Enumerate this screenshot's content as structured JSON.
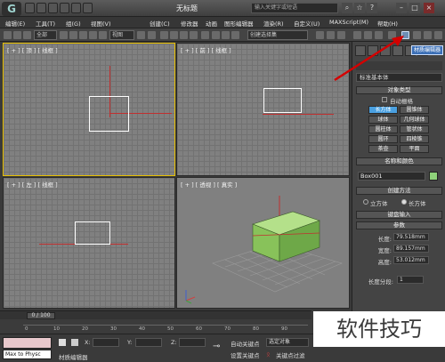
{
  "app": {
    "logo": "G",
    "title": "无标题",
    "search_placeholder": "输入关键字或短语"
  },
  "menu": [
    "编辑(E)",
    "工具(T)",
    "组(G)",
    "视图(V)",
    "创建(C)",
    "修改器",
    "动画",
    "图形编辑器",
    "渲染(R)",
    "自定义(U)",
    "MAXScript(M)",
    "帮助(H)"
  ],
  "toolbar": {
    "filter_select": "全部",
    "view_select": "视图",
    "selection_set": "创建选择集"
  },
  "viewports": [
    {
      "label": "[ + ] [ 顶 ] [ 线框 ]"
    },
    {
      "label": "[ + ] [ 前 ] [ 线框 ]"
    },
    {
      "label": "[ + ] [ 左 ] [ 线框 ]"
    },
    {
      "label": "[ + ] [ 透视 ] [ 真实 ]"
    }
  ],
  "command_panel": {
    "tooltip": "材质编辑器",
    "category_dropdown": "标准基本体",
    "object_type_title": "对象类型",
    "autogrid_label": "自动栅格",
    "object_buttons": [
      "长方体",
      "圆锥体",
      "球体",
      "几何球体",
      "圆柱体",
      "管状体",
      "圆环",
      "四棱锥",
      "茶壶",
      "平面"
    ],
    "selected_object": "长方体",
    "name_color_title": "名称和颜色",
    "object_name": "Box001",
    "object_color": "#8fd37a",
    "creation_method_title": "创建方法",
    "creation_options": [
      "立方体",
      "长方体"
    ],
    "creation_selected": "长方体",
    "keyboard_entry_title": "键盘输入",
    "params_title": "参数",
    "params": [
      {
        "label": "长度:",
        "value": "79.518mm"
      },
      {
        "label": "宽度:",
        "value": "89.157mm"
      },
      {
        "label": "高度:",
        "value": "53.012mm"
      }
    ],
    "length_segs_label": "长度分段:",
    "length_segs_value": "1"
  },
  "timeline": {
    "frame_display": "0 / 100",
    "ticks": [
      "0",
      "10",
      "20",
      "30",
      "40",
      "50",
      "60",
      "70",
      "80",
      "90"
    ]
  },
  "statusbar": {
    "left_label": "Max to Physc",
    "status_text": "材质编辑器",
    "x_label": "X:",
    "y_label": "Y:",
    "z_label": "Z:",
    "auto_key": "自动关键点",
    "set_key": "设置关键点",
    "selected_obj": "选定对象",
    "key_filters": "关键点过滤"
  },
  "watermark": "软件技巧",
  "colors": {
    "viewport_bg": "#808080",
    "box_color": "#9bd46f",
    "accent_blue": "#4aa0e0",
    "active_border": "#e8c000",
    "arrow_red": "#d40000"
  }
}
